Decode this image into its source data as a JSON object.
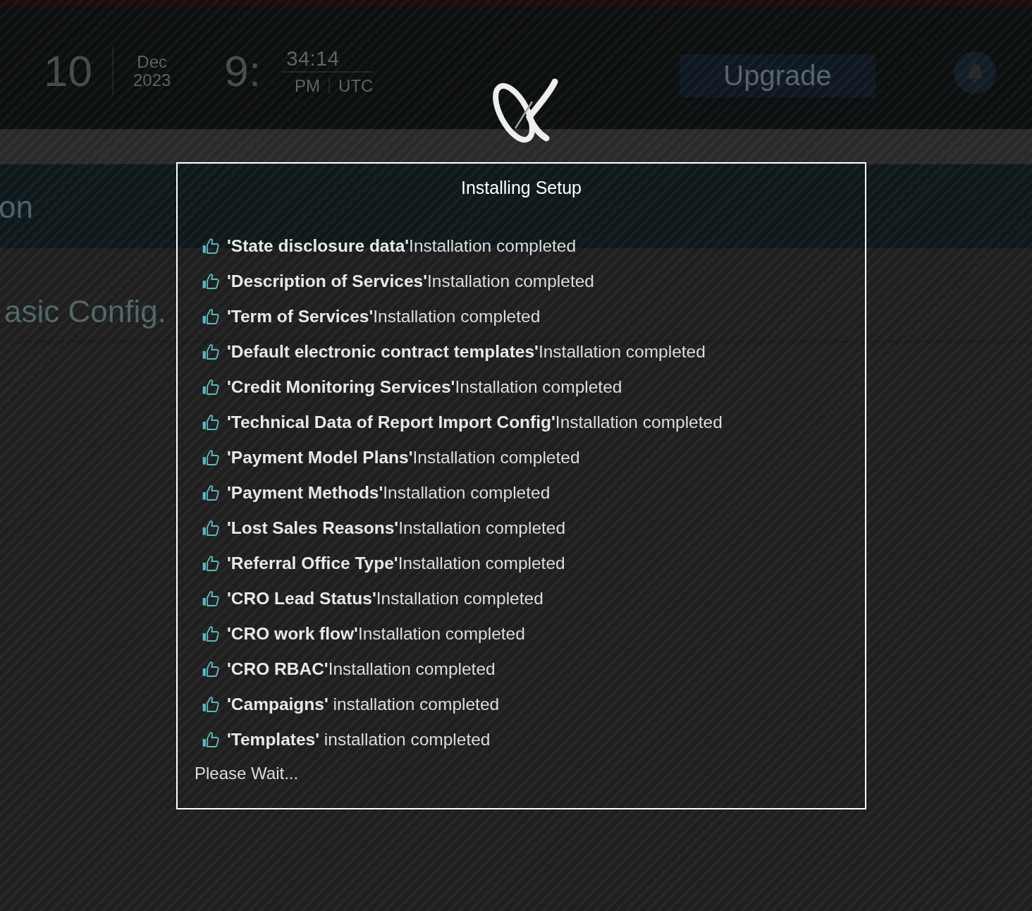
{
  "header": {
    "day": "10",
    "month": "Dec",
    "year": "2023",
    "hour": "9:",
    "minutes_seconds": "34:14",
    "meridiem": "PM",
    "timezone": "UTC",
    "upgrade_button": "Upgrade"
  },
  "banner": {
    "title": "on"
  },
  "section": {
    "title": "asic Config."
  },
  "dialog": {
    "title": "Installing Setup",
    "items": [
      "**'State disclosure data'**Installation completed",
      "**'Description of Services'**Installation completed",
      "**'Term of Services'**Installation completed",
      "**'Default electronic contract templates'**Installation completed",
      "**'Credit Monitoring Services'**Installation completed",
      "**'Technical Data of Report Import Config'**Installation completed",
      "**'Payment Model Plans'**Installation completed",
      "**'Payment Methods'**Installation completed",
      "**'Lost Sales Reasons'**Installation completed",
      "**'Referral Office Type'**Installation completed",
      "**'CRO Lead Status'**Installation completed",
      "**'CRO work flow'**Installation completed",
      "**'CRO RBAC'**Installation completed",
      "**'Campaigns'** installation completed",
      "**'Templates'** installation completed"
    ],
    "status": "Please Wait..."
  }
}
